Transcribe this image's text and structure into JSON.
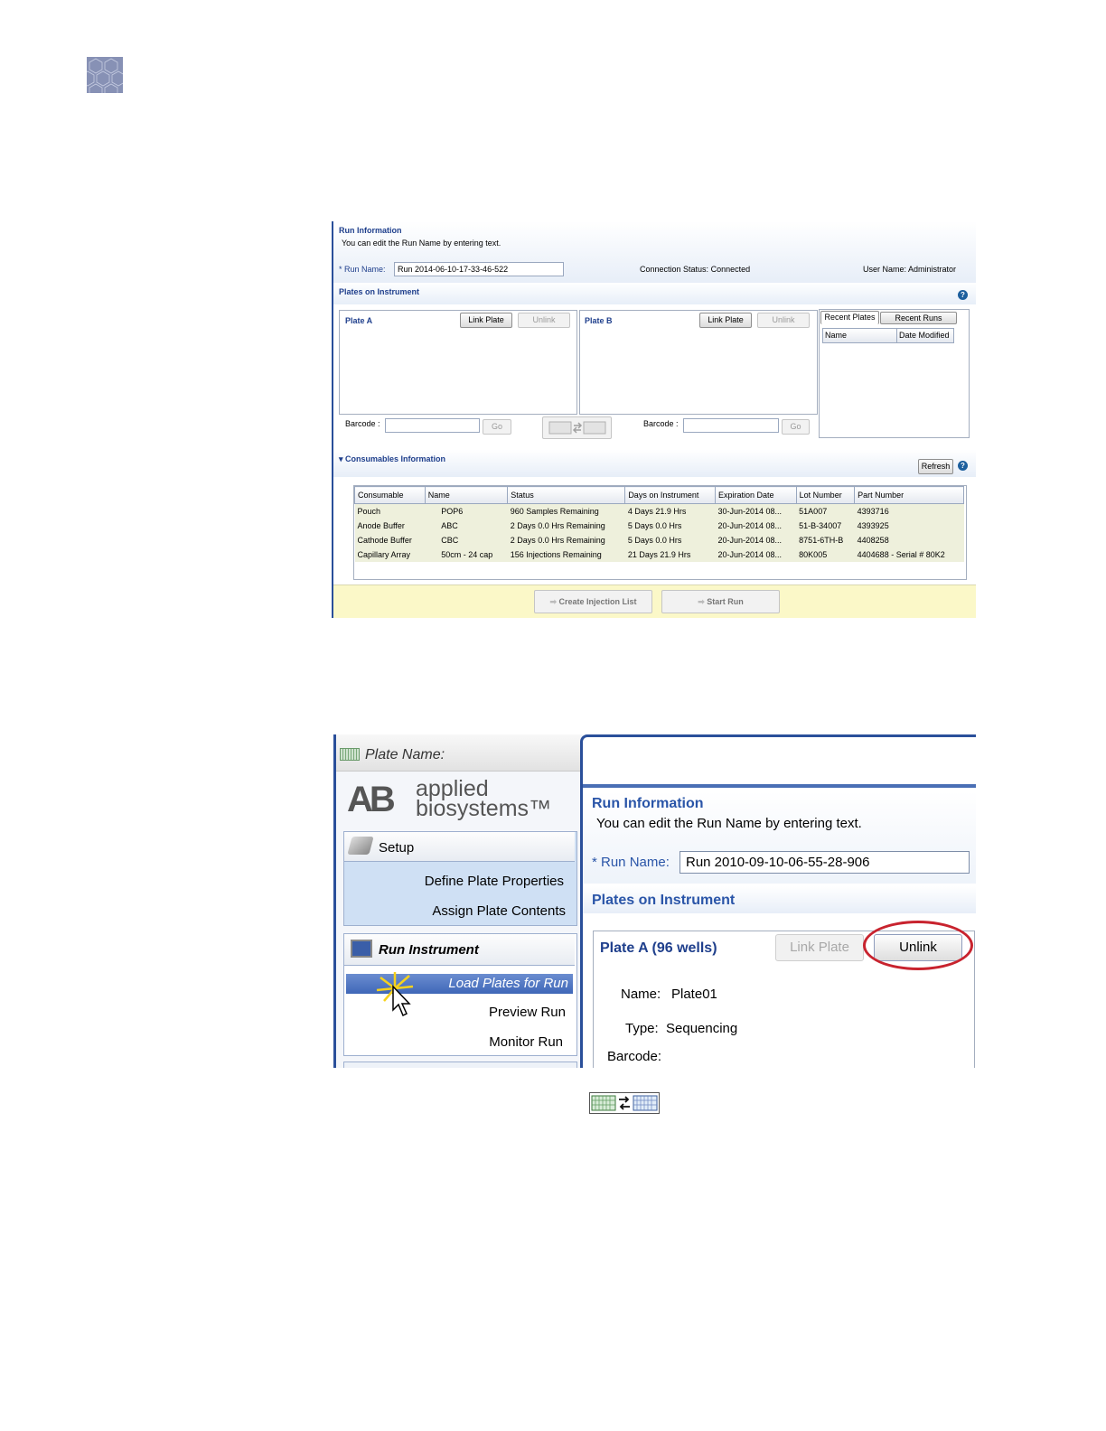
{
  "page_logo_icon": "hexagon-pattern-logo",
  "colors": {
    "accent": "#1f3f8c",
    "nav_highlight": "#3f67b8",
    "highlight_yellow": "#fbf8c8",
    "annotation_red": "#c8232e"
  },
  "screen1": {
    "run_info": {
      "title": "Run Information",
      "instruction": "You can edit the Run Name by entering text.",
      "run_name_label": "* Run Name:",
      "run_name_value": "Run 2014-06-10-17-33-46-522",
      "connection_label": "Connection Status:",
      "connection_value": "Connected",
      "user_label": "User Name:",
      "user_value": "Administrator"
    },
    "plates": {
      "title": "Plates on Instrument",
      "plate_a": {
        "label": "Plate A",
        "link": "Link Plate",
        "unlink": "Unlink"
      },
      "plate_b": {
        "label": "Plate B",
        "link": "Link Plate",
        "unlink": "Unlink"
      },
      "barcode_label": "Barcode :",
      "go": "Go",
      "swap_icon": "swap-plates-icon",
      "tabs": [
        "Recent Plates",
        "Recent Runs"
      ],
      "recent_columns": [
        "Name",
        "Date Modified"
      ]
    },
    "consumables": {
      "title": "Consumables Information",
      "refresh": "Refresh",
      "columns": [
        "Consumable",
        "Name",
        "Status",
        "Days on Instrument",
        "Expiration Date",
        "Lot Number",
        "Part Number"
      ],
      "rows": [
        [
          "Pouch",
          "POP6",
          "960 Samples Remaining",
          "4 Days 21.9 Hrs",
          "30-Jun-2014 08...",
          "51A007",
          "4393716"
        ],
        [
          "Anode Buffer",
          "ABC",
          "2 Days 0.0 Hrs Remaining",
          "5 Days 0.0 Hrs",
          "20-Jun-2014 08...",
          "51-B-34007",
          "4393925"
        ],
        [
          "Cathode Buffer",
          "CBC",
          "2 Days 0.0 Hrs Remaining",
          "5 Days 0.0 Hrs",
          "20-Jun-2014 08...",
          "8751-6TH-B",
          "4408258"
        ],
        [
          "Capillary Array",
          "50cm - 24 cap",
          "156 Injections Remaining",
          "21 Days 21.9 Hrs",
          "20-Jun-2014 08...",
          "80K005",
          "4404688 - Serial # 80K2"
        ]
      ]
    },
    "actions": {
      "create_injection": "Create Injection List",
      "start_run": "Start Run"
    }
  },
  "screen2": {
    "plate_name_label": "Plate Name:",
    "brand": {
      "mark": "AB",
      "line1": "applied",
      "line2": "biosystems™"
    },
    "nav": {
      "setup": "Setup",
      "setup_items": [
        "Define Plate Properties",
        "Assign Plate Contents"
      ],
      "run_instrument": "Run Instrument",
      "run_items": [
        "Load Plates for Run",
        "Preview Run",
        "Monitor Run"
      ]
    },
    "run_info": {
      "title": "Run Information",
      "instruction": "You can edit the Run Name by entering text.",
      "run_name_label": "* Run Name:",
      "run_name_value": "Run 2010-09-10-06-55-28-906"
    },
    "plates": {
      "title": "Plates on Instrument",
      "plate_a_label": "Plate A (96 wells)",
      "link": "Link Plate",
      "unlink": "Unlink",
      "name_label": "Name:",
      "name_value": "Plate01",
      "type_label": "Type:",
      "type_value": "Sequencing",
      "barcode_label": "Barcode:"
    }
  },
  "bottom_icon": "swap-plates-icon"
}
